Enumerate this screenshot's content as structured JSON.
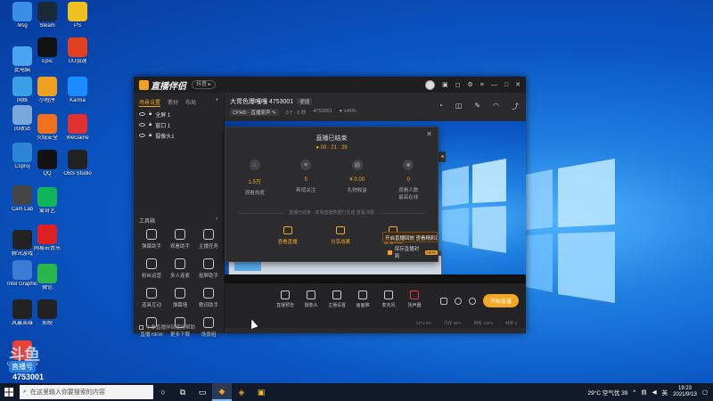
{
  "desktop": {
    "icons": [
      {
        "label": "Msg",
        "color": "#3a8ee6"
      },
      {
        "label": "此电脑",
        "color": "#4aa3f0"
      },
      {
        "label": "网络",
        "color": "#39a0e8"
      },
      {
        "label": "回收站",
        "color": "#7aa8d8"
      },
      {
        "label": "Csproj",
        "color": "#2c84d6"
      },
      {
        "label": "Cam Lab",
        "color": "#444"
      },
      {
        "label": "腾讯游戏",
        "color": "#222"
      },
      {
        "label": "Intel Graphics",
        "color": "#3b7bd4"
      },
      {
        "label": "风暴英雄",
        "color": "#222"
      },
      {
        "label": "Google Chrome",
        "color": "#ea4335"
      },
      {
        "label": "Steam",
        "color": "#1b2838"
      },
      {
        "label": "Epic",
        "color": "#111"
      },
      {
        "label": "小程序",
        "color": "#f0a020"
      },
      {
        "label": "火绒安全",
        "color": "#f07020"
      },
      {
        "label": "QQ",
        "color": "#111"
      },
      {
        "label": "爱奇艺",
        "color": "#11b45a"
      },
      {
        "label": "网易云音乐",
        "color": "#e02020"
      },
      {
        "label": "微信",
        "color": "#2ab54a"
      },
      {
        "label": "剪映",
        "color": "#222"
      },
      {
        "label": "PS",
        "color": "#f0c020"
      },
      {
        "label": "UU加速",
        "color": "#e04020"
      },
      {
        "label": "Karma",
        "color": "#1a8cff"
      },
      {
        "label": "WeGame",
        "color": "#e03030"
      },
      {
        "label": "OBS Studio",
        "color": "#222"
      }
    ],
    "watermark": {
      "line1": "斗鱼",
      "line2": "直播号",
      "line3": "4753001"
    }
  },
  "taskbar": {
    "search_placeholder": "在这里输入你要搜索的内容",
    "weather": "29°C 空气优 39",
    "time": "19:23",
    "date": "2021/9/13"
  },
  "app": {
    "logo_text": "直播伴侣",
    "version_pill": "抖音 ▸",
    "tabs": [
      "场景设置",
      "素材",
      "布局"
    ],
    "sources": [
      "全屏 1",
      "窗口 1",
      "摄像头1"
    ],
    "tools_title": "工具箱",
    "tools": [
      "弹幕助手",
      "观看助手",
      "主播任务",
      "粉丝运营",
      "多人连麦",
      "投屏助手",
      "道具互动",
      "弹幕墙",
      "歌词助手",
      "直播 NEW",
      "更多下载",
      "场景组"
    ],
    "footer_label": "小象直播伴侣使用帮助",
    "stream_title": "大胃色爆嘎嘎 4753001",
    "stream_tag": "便捷",
    "stream_sub": [
      "CPHD · 直播原声 ✎",
      "0 T · 0 秒",
      "4753001",
      "♥ 146%"
    ],
    "bottom_buttons": [
      "直播预告",
      "摄像头",
      "主播设置",
      "画面推",
      "麦克风",
      "扬声器"
    ],
    "start_live": "开始直播",
    "status": [
      "CPU 8%",
      "内存 36%",
      "网络 100%",
      "帧率 0"
    ]
  },
  "end_dialog": {
    "title": "直播已结束",
    "time": "● 00 : 21 : 29",
    "stats": [
      {
        "value": "1.5万",
        "label": "观看热度"
      },
      {
        "value": "0",
        "label": "新增关注"
      },
      {
        "value": "¥ 0.00",
        "label": "礼物收益"
      },
      {
        "value": "0",
        "label": "观看人数\n最高在线"
      }
    ],
    "divider_text": "直播已结束 · 本场直播数据已生成 查看详情",
    "actions": [
      "查看直播",
      "分享战果",
      "直播回放"
    ],
    "tip": "开启直播回放 查看精彩回放",
    "save_label": "保存直播封面",
    "save_badge": "NEW"
  }
}
